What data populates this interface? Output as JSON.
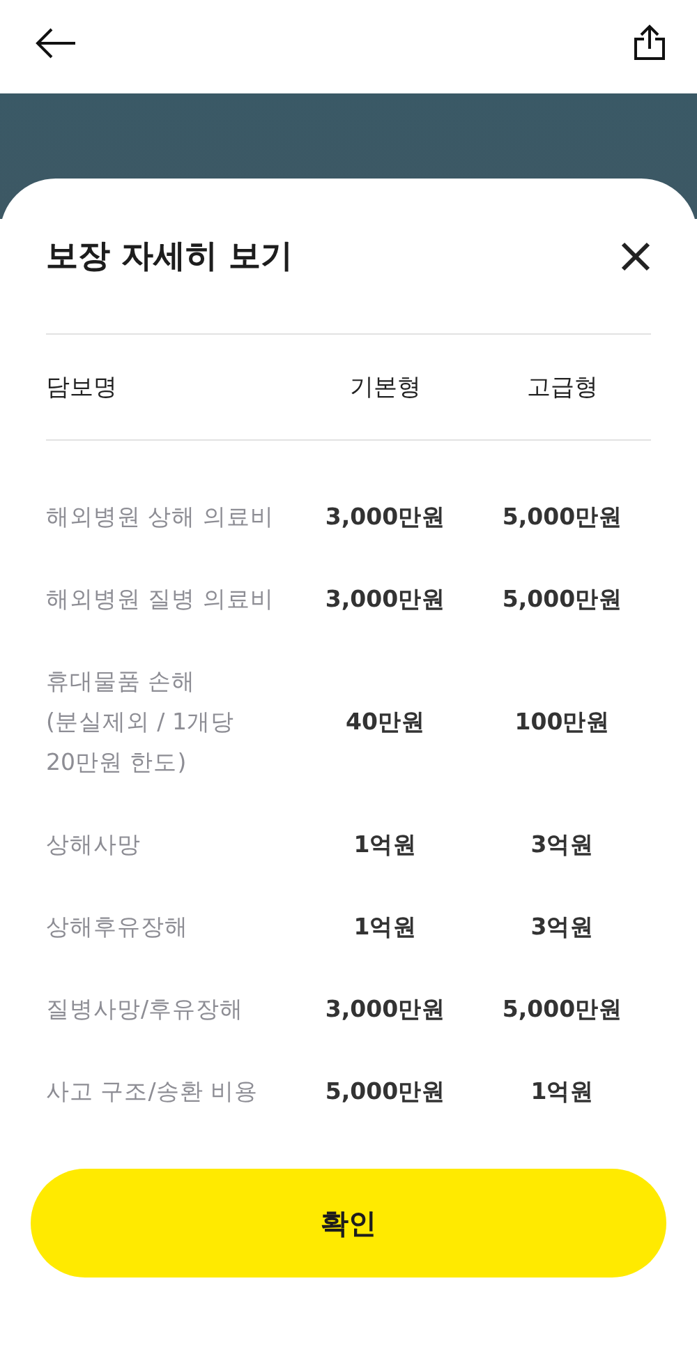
{
  "sheet": {
    "title": "보장 자세히 보기"
  },
  "table": {
    "columns": [
      "담보명",
      "기본형",
      "고급형"
    ],
    "rows": [
      {
        "name": "해외병원 상해 의료비",
        "basic": "3,000만원",
        "premium": "5,000만원"
      },
      {
        "name": "해외병원 질병 의료비",
        "basic": "3,000만원",
        "premium": "5,000만원"
      },
      {
        "name": "휴대물품 손해\n(분실제외 / 1개당\n20만원 한도)",
        "basic": "40만원",
        "premium": "100만원"
      },
      {
        "name": "상해사망",
        "basic": "1억원",
        "premium": "3억원"
      },
      {
        "name": "상해후유장해",
        "basic": "1억원",
        "premium": "3억원"
      },
      {
        "name": "질병사망/후유장해",
        "basic": "3,000만원",
        "premium": "5,000만원"
      },
      {
        "name": "사고 구조/송환 비용",
        "basic": "5,000만원",
        "premium": "1억원"
      }
    ]
  },
  "confirm_button": "확인"
}
